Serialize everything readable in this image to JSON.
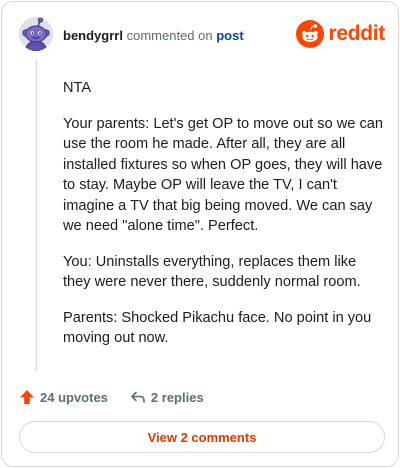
{
  "comment": {
    "author": "bendygrrl",
    "action_text": "commented on",
    "target": "post",
    "paragraphs": [
      "NTA",
      "Your parents: Let's get OP to move out so we can use the room he made. After all, they are all installed fixtures so when OP goes, they will have to stay. Maybe OP will leave the TV, I can't imagine a TV that big being moved. We can say we need \"alone time\". Perfect.",
      "You: Uninstalls everything, replaces them like they were never there, suddenly normal room.",
      "Parents: Shocked Pikachu face. No point in you moving out now."
    ]
  },
  "brand": {
    "name": "reddit",
    "color": "#ff4500"
  },
  "footer": {
    "upvotes_label": "24 upvotes",
    "replies_label": "2 replies",
    "view_comments_label": "View 2 comments"
  },
  "icons": {
    "upvote": "upvote-arrow-icon",
    "reply": "reply-arrow-icon",
    "avatar": "snoo-avatar",
    "brand": "reddit-snoo-logo"
  },
  "colors": {
    "accent": "#ff4500",
    "link": "#0a449b",
    "muted": "#576f76",
    "button_text": "#d93a00",
    "border": "#d6d9dc"
  }
}
